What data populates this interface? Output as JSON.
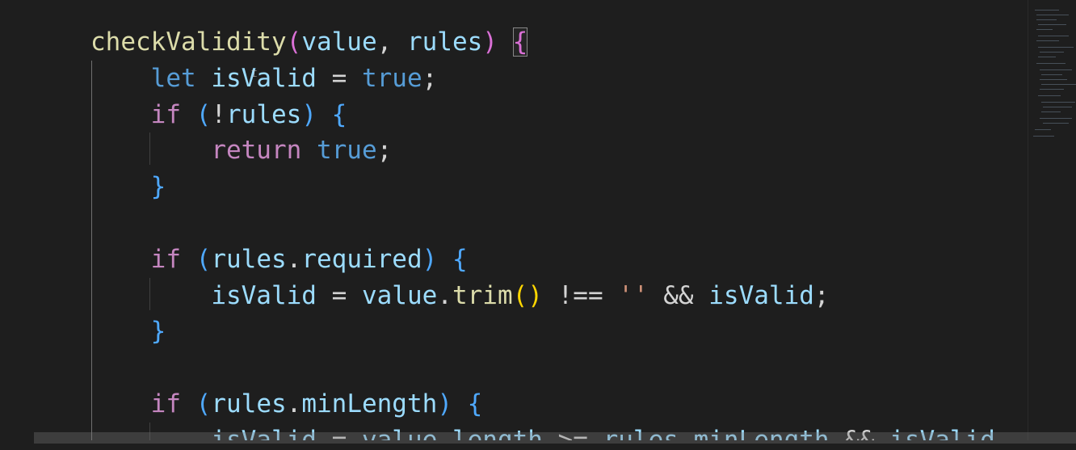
{
  "editor": {
    "language": "javascript",
    "colors": {
      "background": "#1e1e1e",
      "function": "#dcdcaa",
      "variable": "#9cdcfe",
      "keyword": "#569cd6",
      "control": "#c586c0",
      "string": "#ce9178"
    },
    "lines": [
      [
        {
          "t": "checkValidity",
          "c": "fn"
        },
        {
          "t": "(",
          "c": "br1"
        },
        {
          "t": "value",
          "c": "var"
        },
        {
          "t": ", ",
          "c": "pun"
        },
        {
          "t": "rules",
          "c": "var"
        },
        {
          "t": ")",
          "c": "br1"
        },
        {
          "t": " ",
          "c": "pun"
        },
        {
          "t": "{",
          "c": "br1",
          "match": true
        }
      ],
      [
        {
          "t": "    "
        },
        {
          "t": "let",
          "c": "kw"
        },
        {
          "t": " "
        },
        {
          "t": "isValid",
          "c": "var"
        },
        {
          "t": " = ",
          "c": "pun"
        },
        {
          "t": "true",
          "c": "kw"
        },
        {
          "t": ";",
          "c": "pun"
        }
      ],
      [
        {
          "t": "    "
        },
        {
          "t": "if",
          "c": "ctl"
        },
        {
          "t": " "
        },
        {
          "t": "(",
          "c": "br2"
        },
        {
          "t": "!",
          "c": "pun"
        },
        {
          "t": "rules",
          "c": "var"
        },
        {
          "t": ")",
          "c": "br2"
        },
        {
          "t": " "
        },
        {
          "t": "{",
          "c": "br2"
        }
      ],
      [
        {
          "t": "        "
        },
        {
          "t": "return",
          "c": "ctl"
        },
        {
          "t": " "
        },
        {
          "t": "true",
          "c": "kw"
        },
        {
          "t": ";",
          "c": "pun"
        }
      ],
      [
        {
          "t": "    "
        },
        {
          "t": "}",
          "c": "br2"
        }
      ],
      [
        {
          "t": ""
        }
      ],
      [
        {
          "t": "    "
        },
        {
          "t": "if",
          "c": "ctl"
        },
        {
          "t": " "
        },
        {
          "t": "(",
          "c": "br2"
        },
        {
          "t": "rules",
          "c": "var"
        },
        {
          "t": ".",
          "c": "pun"
        },
        {
          "t": "required",
          "c": "var"
        },
        {
          "t": ")",
          "c": "br2"
        },
        {
          "t": " "
        },
        {
          "t": "{",
          "c": "br2"
        }
      ],
      [
        {
          "t": "        "
        },
        {
          "t": "isValid",
          "c": "var"
        },
        {
          "t": " = ",
          "c": "pun"
        },
        {
          "t": "value",
          "c": "var"
        },
        {
          "t": ".",
          "c": "pun"
        },
        {
          "t": "trim",
          "c": "fn"
        },
        {
          "t": "()",
          "c": "br3"
        },
        {
          "t": " !== ",
          "c": "pun"
        },
        {
          "t": "''",
          "c": "str"
        },
        {
          "t": " && ",
          "c": "pun"
        },
        {
          "t": "isValid",
          "c": "var"
        },
        {
          "t": ";",
          "c": "pun"
        }
      ],
      [
        {
          "t": "    "
        },
        {
          "t": "}",
          "c": "br2"
        }
      ],
      [
        {
          "t": ""
        }
      ],
      [
        {
          "t": "    "
        },
        {
          "t": "if",
          "c": "ctl"
        },
        {
          "t": " "
        },
        {
          "t": "(",
          "c": "br2"
        },
        {
          "t": "rules",
          "c": "var"
        },
        {
          "t": ".",
          "c": "pun"
        },
        {
          "t": "minLength",
          "c": "var"
        },
        {
          "t": ")",
          "c": "br2"
        },
        {
          "t": " "
        },
        {
          "t": "{",
          "c": "br2"
        }
      ],
      [
        {
          "t": "        "
        },
        {
          "t": "isValid",
          "c": "var"
        },
        {
          "t": " = ",
          "c": "pun"
        },
        {
          "t": "value",
          "c": "var"
        },
        {
          "t": ".",
          "c": "pun"
        },
        {
          "t": "length",
          "c": "var"
        },
        {
          "t": " >= ",
          "c": "pun"
        },
        {
          "t": "rules",
          "c": "var"
        },
        {
          "t": ".",
          "c": "pun"
        },
        {
          "t": "minLength",
          "c": "var"
        },
        {
          "t": " && ",
          "c": "pun"
        },
        {
          "t": "isValid",
          "c": "var"
        }
      ]
    ]
  }
}
